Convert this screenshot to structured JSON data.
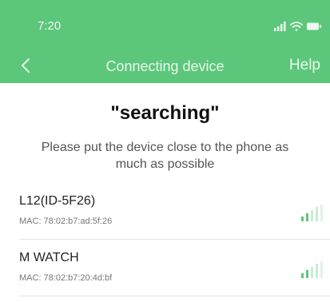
{
  "status_bar": {
    "time": "7:20",
    "icons": [
      "cellular-signal-icon",
      "wifi-icon",
      "battery-icon"
    ]
  },
  "nav": {
    "back_icon": "chevron-left-icon",
    "title": "Connecting device",
    "help_label": "Help"
  },
  "main": {
    "title": "\"searching\"",
    "instruction": "Please put the device close to the phone as much as possible"
  },
  "devices": [
    {
      "name": "L12(ID-5F26)",
      "mac": "MAC: 78:02:b7:ad:5f:26",
      "signal_icon": "signal-strength-icon"
    },
    {
      "name": "M WATCH",
      "mac": "MAC: 78:02:b7:20:4d:bf",
      "signal_icon": "signal-strength-icon"
    }
  ],
  "colors": {
    "header": "#5cc77a",
    "signal_active": "#5cc77a",
    "signal_inactive": "#c9ebd2"
  }
}
